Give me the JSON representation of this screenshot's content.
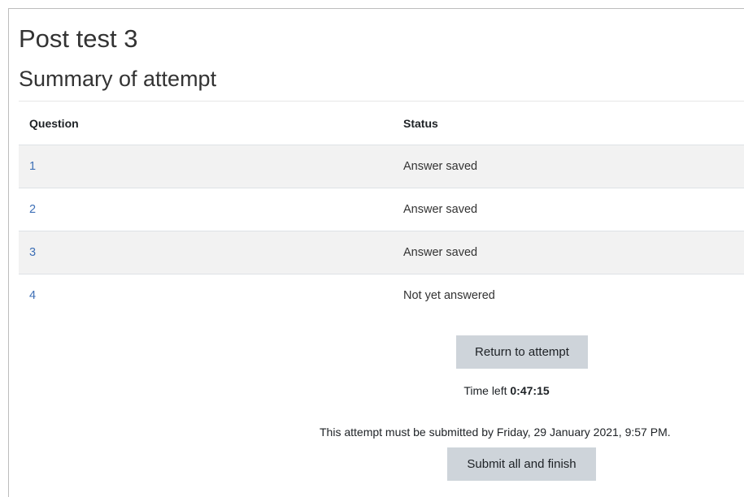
{
  "header": {
    "title": "Post test 3",
    "subtitle": "Summary of attempt"
  },
  "table": {
    "columns": [
      "Question",
      "Status"
    ],
    "rows": [
      {
        "question": "1",
        "status": "Answer saved"
      },
      {
        "question": "2",
        "status": "Answer saved"
      },
      {
        "question": "3",
        "status": "Answer saved"
      },
      {
        "question": "4",
        "status": "Not yet answered"
      }
    ]
  },
  "actions": {
    "return_label": "Return to attempt",
    "time_left_label": "Time left",
    "time_left_value": "0:47:15",
    "deadline_text": "This attempt must be submitted by Friday, 29 January 2021, 9:57 PM.",
    "submit_label": "Submit all and finish"
  },
  "colors": {
    "link": "#3d6fb6",
    "button_bg": "#ced4da",
    "row_stripe": "#f2f2f2"
  }
}
